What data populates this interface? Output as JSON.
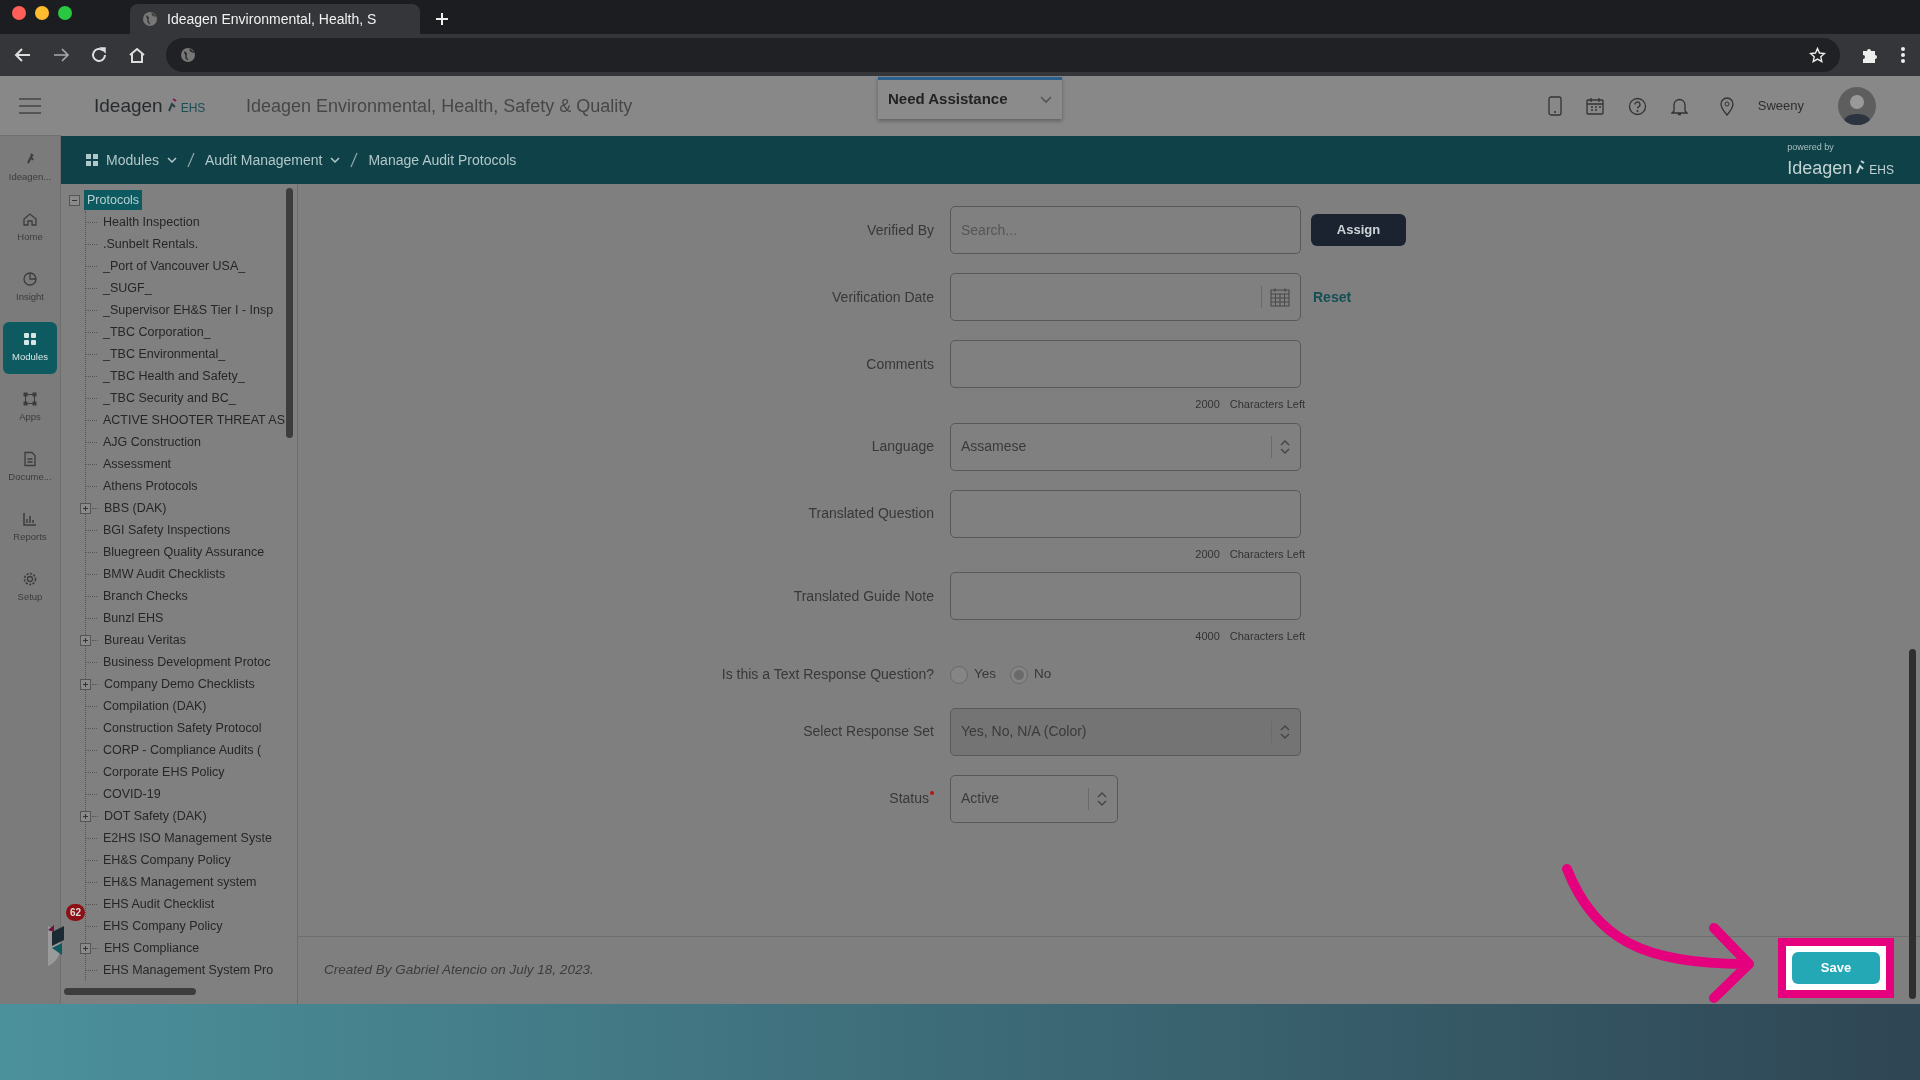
{
  "browser": {
    "tab_title": "Ideagen Environmental, Health, S"
  },
  "rail": [
    {
      "label": "Ideagen...",
      "selected": false
    },
    {
      "label": "Home",
      "selected": false
    },
    {
      "label": "Insight",
      "selected": false
    },
    {
      "label": "Modules",
      "selected": true
    },
    {
      "label": "Apps",
      "selected": false
    },
    {
      "label": "Docume...",
      "selected": false
    },
    {
      "label": "Reports",
      "selected": false
    },
    {
      "label": "Setup",
      "selected": false
    }
  ],
  "header": {
    "logo": "Ideagen",
    "logo_suffix": "EHS",
    "title": "Ideagen Environmental, Health, Safety & Quality",
    "assist": "Need Assistance",
    "user": "Sweeny"
  },
  "breadcrumb": [
    {
      "label": "Modules",
      "dropdown": true
    },
    {
      "label": "Audit Management",
      "dropdown": true
    },
    {
      "label": "Manage Audit Protocols",
      "dropdown": false
    }
  ],
  "powered": {
    "caption": "powered by",
    "logo": "Ideagen",
    "suffix": "EHS"
  },
  "tree": {
    "label": "Protocols",
    "selected": true,
    "expanded": true,
    "children": [
      {
        "label": "Health Inspection",
        "expandable": false
      },
      {
        "label": ".Sunbelt Rentals.",
        "expandable": false
      },
      {
        "label": "_Port of Vancouver USA_",
        "expandable": false
      },
      {
        "label": "_SUGF_",
        "expandable": false
      },
      {
        "label": "_Supervisor EH&S Tier I - Insp",
        "expandable": false
      },
      {
        "label": "_TBC Corporation_",
        "expandable": false
      },
      {
        "label": "_TBC Environmental_",
        "expandable": false
      },
      {
        "label": "_TBC Health and Safety_",
        "expandable": false
      },
      {
        "label": "_TBC Security and BC_",
        "expandable": false
      },
      {
        "label": "ACTIVE SHOOTER THREAT AS",
        "expandable": false
      },
      {
        "label": "AJG Construction",
        "expandable": false
      },
      {
        "label": "Assessment",
        "expandable": false
      },
      {
        "label": "Athens Protocols",
        "expandable": false
      },
      {
        "label": "BBS (DAK)",
        "expandable": true
      },
      {
        "label": "BGI Safety Inspections",
        "expandable": false
      },
      {
        "label": "Bluegreen Quality Assurance",
        "expandable": false
      },
      {
        "label": "BMW Audit Checklists",
        "expandable": false
      },
      {
        "label": "Branch Checks",
        "expandable": false
      },
      {
        "label": "Bunzl EHS",
        "expandable": false
      },
      {
        "label": "Bureau Veritas",
        "expandable": true
      },
      {
        "label": "Business Development Protoc",
        "expandable": false
      },
      {
        "label": "Company Demo Checklists",
        "expandable": true
      },
      {
        "label": "Compilation (DAK)",
        "expandable": false
      },
      {
        "label": "Construction Safety Protocol",
        "expandable": false
      },
      {
        "label": "CORP - Compliance Audits (",
        "expandable": false
      },
      {
        "label": "Corporate EHS Policy",
        "expandable": false
      },
      {
        "label": "COVID-19",
        "expandable": false
      },
      {
        "label": "DOT Safety (DAK)",
        "expandable": true
      },
      {
        "label": "E2HS ISO Management Syste",
        "expandable": false
      },
      {
        "label": "EH&S Company Policy",
        "expandable": false
      },
      {
        "label": "EH&S Management system",
        "expandable": false
      },
      {
        "label": "EHS Audit Checklist",
        "expandable": false
      },
      {
        "label": "EHS Company Policy",
        "expandable": false
      },
      {
        "label": "EHS Compliance",
        "expandable": true
      },
      {
        "label": "EHS Management System Pro",
        "expandable": false
      }
    ]
  },
  "chat_badge": "62",
  "form": {
    "fields": [
      {
        "kind": "search",
        "label": "Verified By",
        "placeholder": "Search...",
        "action": "Assign",
        "required": false
      },
      {
        "kind": "date",
        "label": "Verification Date",
        "action": "Reset",
        "required": false
      },
      {
        "kind": "textarea",
        "label": "Comments",
        "count": "2000",
        "count_label": "Characters Left",
        "required": false
      },
      {
        "kind": "select",
        "label": "Language",
        "value": "Assamese",
        "disabled": false,
        "narrow": false,
        "required": false
      },
      {
        "kind": "textarea",
        "label": "Translated Question",
        "count": "2000",
        "count_label": "Characters Left",
        "required": false
      },
      {
        "kind": "textarea",
        "label": "Translated Guide Note",
        "count": "4000",
        "count_label": "Characters Left",
        "required": false
      },
      {
        "kind": "radio",
        "label": "Is this a Text Response Question?",
        "required": false,
        "options": [
          {
            "label": "Yes",
            "selected": false
          },
          {
            "label": "No",
            "selected": true
          }
        ]
      },
      {
        "kind": "select",
        "label": "Select Response Set",
        "value": "Yes, No, N/A (Color)",
        "disabled": true,
        "narrow": false,
        "required": false
      },
      {
        "kind": "select",
        "label": "Status",
        "value": "Active",
        "disabled": false,
        "narrow": true,
        "required": true
      }
    ]
  },
  "footer": {
    "created": "Created By  Gabriel Atencio on July 18, 2023.",
    "save": "Save"
  }
}
